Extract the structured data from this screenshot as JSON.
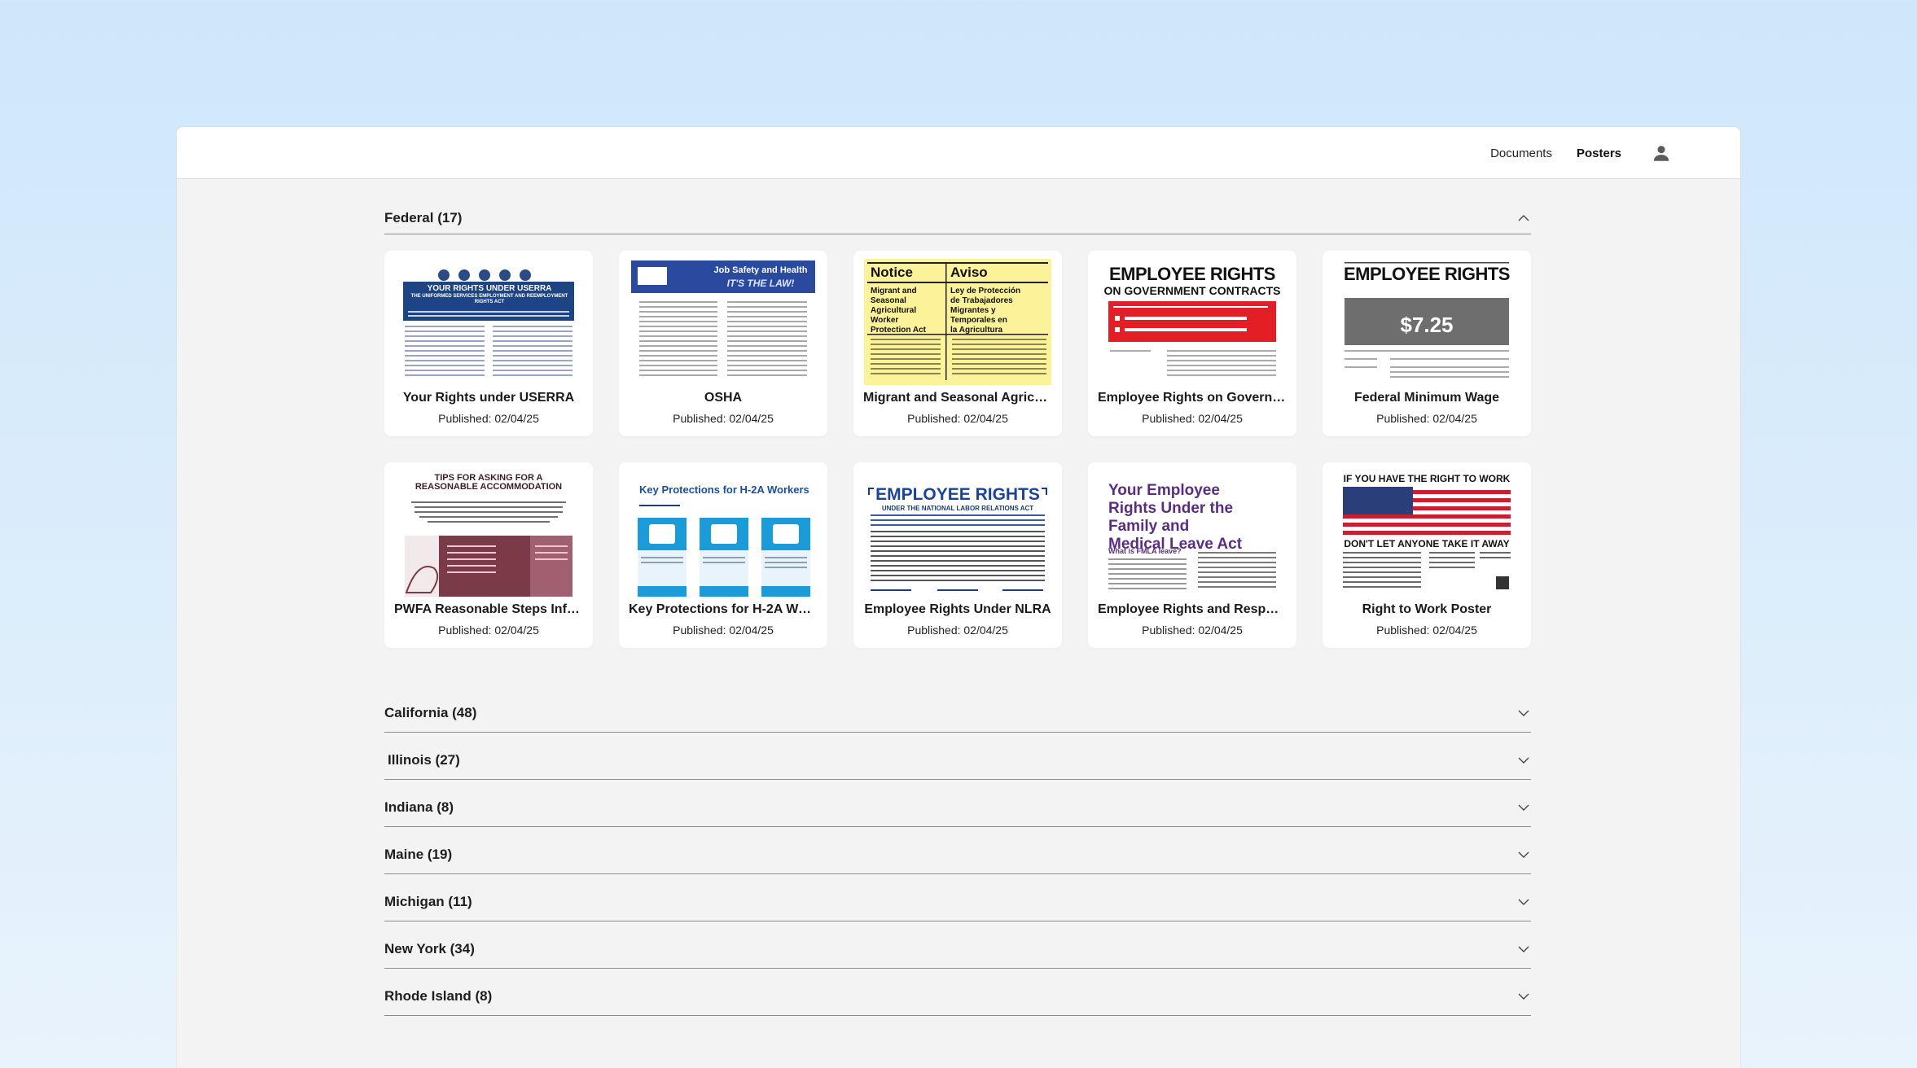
{
  "nav": {
    "documents": "Documents",
    "posters": "Posters"
  },
  "federal": {
    "title": "Federal (17)",
    "cards": [
      {
        "title": "Your Rights under USERRA",
        "date": "Published: 02/04/25",
        "thumb_text": "YOUR RIGHTS UNDER USERRA",
        "thumb_sub": "THE UNIFORMED SERVICES EMPLOYMENT AND REEMPLOYMENT RIGHTS ACT"
      },
      {
        "title": "OSHA",
        "date": "Published: 02/04/25",
        "thumb_text": "Job Safety and Health",
        "thumb_sub": "IT'S THE LAW!"
      },
      {
        "title": "Migrant and Seasonal Agricul...",
        "date": "Published: 02/04/25",
        "thumb_text": "Notice",
        "thumb_sub": "Aviso"
      },
      {
        "title": "Employee Rights on Governme...",
        "date": "Published: 02/04/25",
        "thumb_text": "EMPLOYEE RIGHTS",
        "thumb_sub": "ON GOVERNMENT CONTRACTS"
      },
      {
        "title": "Federal Minimum Wage",
        "date": "Published: 02/04/25",
        "thumb_text": "EMPLOYEE RIGHTS",
        "thumb_sub": "$7.25"
      },
      {
        "title": "PWFA Reasonable Steps Info...",
        "date": "Published: 02/04/25",
        "thumb_text": "TIPS FOR ASKING FOR A REASONABLE ACCOMMODATION",
        "thumb_sub": ""
      },
      {
        "title": "Key Protections for H-2A Wor...",
        "date": "Published: 02/04/25",
        "thumb_text": "Key Protections for H-2A Workers",
        "thumb_sub": ""
      },
      {
        "title": "Employee Rights Under NLRA",
        "date": "Published: 02/04/25",
        "thumb_text": "EMPLOYEE RIGHTS",
        "thumb_sub": "UNDER THE NATIONAL LABOR RELATIONS ACT"
      },
      {
        "title": "Employee Rights and Respons...",
        "date": "Published: 02/04/25",
        "thumb_text": "Your Employee Rights Under the Family and Medical Leave Act",
        "thumb_sub": "What is FMLA leave?"
      },
      {
        "title": "Right to Work Poster",
        "date": "Published: 02/04/25",
        "thumb_text": "IF YOU HAVE THE RIGHT TO WORK",
        "thumb_sub": "DON'T LET ANYONE TAKE IT AWAY"
      }
    ]
  },
  "states": [
    {
      "title": "California (48)"
    },
    {
      "title": "Illinois (27)"
    },
    {
      "title": "Indiana (8)"
    },
    {
      "title": "Maine (19)"
    },
    {
      "title": "Michigan (11)"
    },
    {
      "title": "New York (34)"
    },
    {
      "title": "Rhode Island (8)"
    }
  ],
  "colors": {
    "accent_blue": "#1f4e8c",
    "nav_text": "#222222",
    "divider": "#8b8b8b"
  }
}
